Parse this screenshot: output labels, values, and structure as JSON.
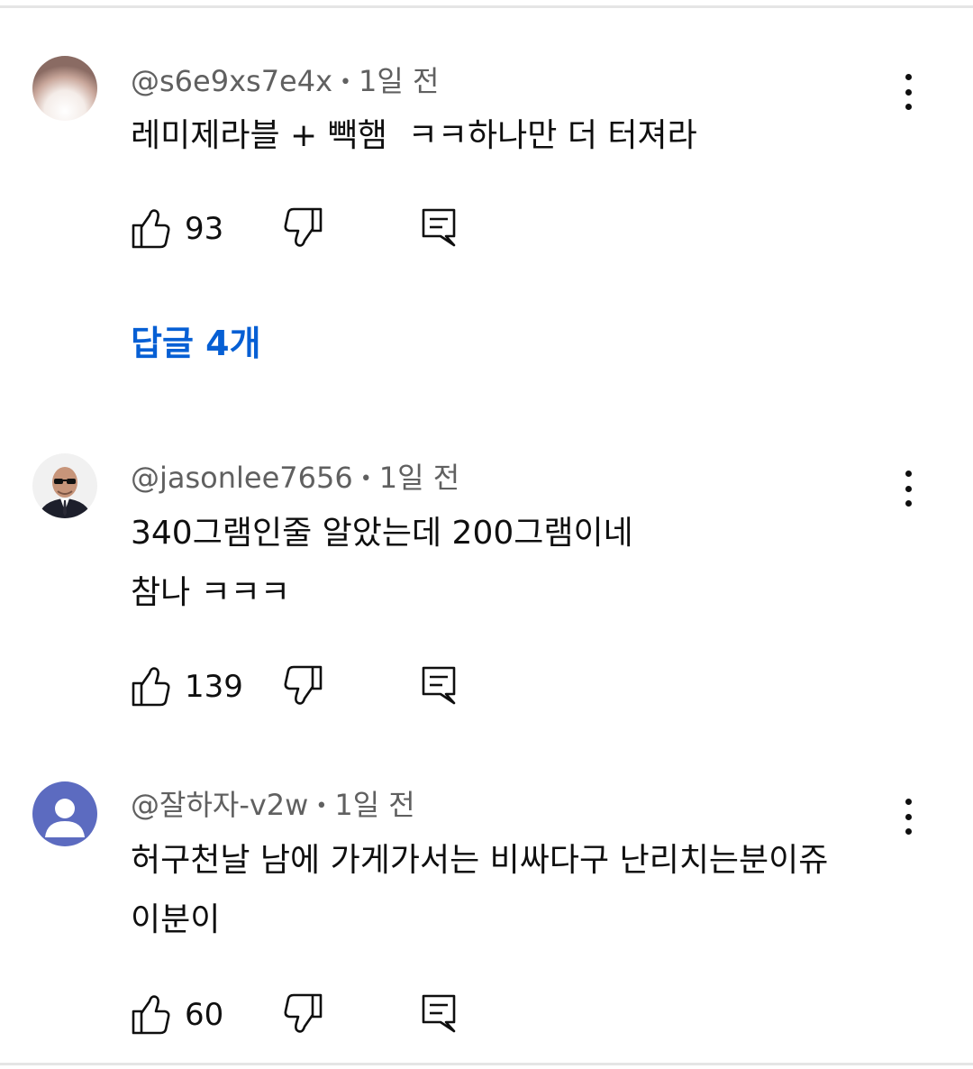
{
  "comments": [
    {
      "author": "@s6e9xs7e4x",
      "separator": "•",
      "time": "1일 전",
      "text": "레미제라블 + 빽햄  ㅋㅋ하나만 더 터져라",
      "likes": "93",
      "avatar": "blurred-photo-avatar",
      "replies_label": "답글 4개"
    },
    {
      "author": "@jasonlee7656",
      "separator": "•",
      "time": "1일 전",
      "text": "340그램인줄 알았는데 200그램이네\n참나 ㅋㅋㅋ",
      "likes": "139",
      "avatar": "man-in-suit-avatar"
    },
    {
      "author": "@잘하자-v2w",
      "separator": "•",
      "time": "1일 전",
      "text": "허구천날 남에 가게가서는 비싸다구 난리치는분이쥬\n이분이",
      "likes": "60",
      "avatar": "default-person-avatar"
    }
  ],
  "colors": {
    "link": "#065fd4",
    "meta": "#606060",
    "text": "#0f0f0f",
    "default_avatar_bg": "#5c6bc0",
    "divider": "#e5e5e5"
  }
}
